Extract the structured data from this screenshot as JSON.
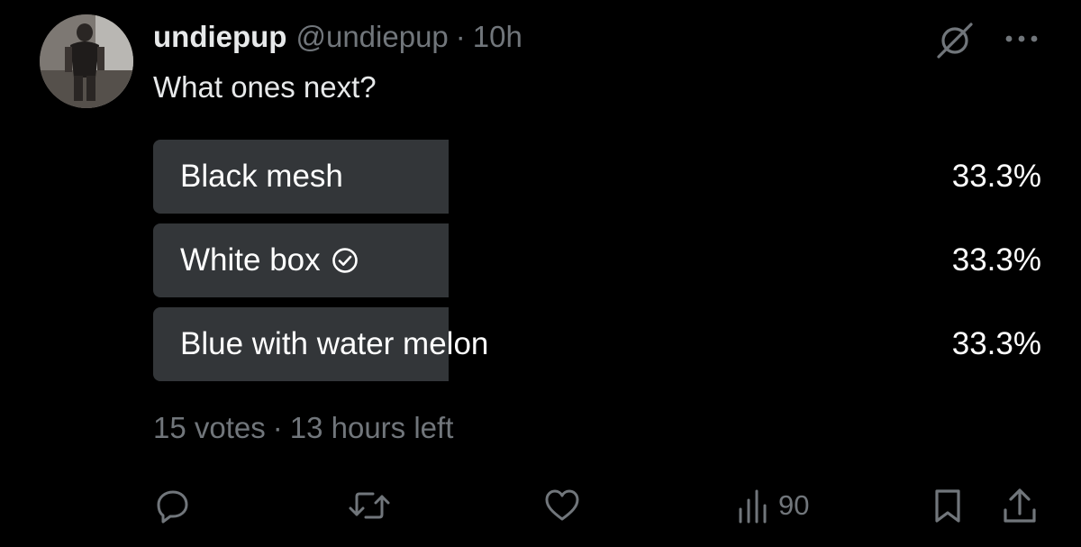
{
  "tweet": {
    "display_name": "undiepup",
    "handle": "@undiepup",
    "separator": "·",
    "time": "10h",
    "text": "What ones next?",
    "avatar": "user-avatar-photo",
    "icons": {
      "grok": "grok-icon",
      "more": "more-dots-icon"
    }
  },
  "poll": {
    "options": [
      {
        "label": "Black mesh",
        "percent": "33.3%",
        "share": 0.333,
        "selected": false
      },
      {
        "label": "White box",
        "percent": "33.3%",
        "share": 0.333,
        "selected": true
      },
      {
        "label": "Blue with water melon",
        "percent": "33.3%",
        "share": 0.333,
        "selected": false
      }
    ],
    "votes": "15 votes",
    "separator": "·",
    "time_left": "13 hours left",
    "selected_icon": "check-circle-icon"
  },
  "actions": {
    "reply_icon": "reply-icon",
    "retweet_icon": "retweet-icon",
    "like_icon": "heart-icon",
    "views_icon": "views-chart-icon",
    "views_count": "90",
    "bookmark_icon": "bookmark-icon",
    "share_icon": "share-icon"
  },
  "colors": {
    "background": "#000000",
    "primary_text": "#e7e9ea",
    "secondary_text": "#71767b",
    "poll_bar": "#333639"
  }
}
